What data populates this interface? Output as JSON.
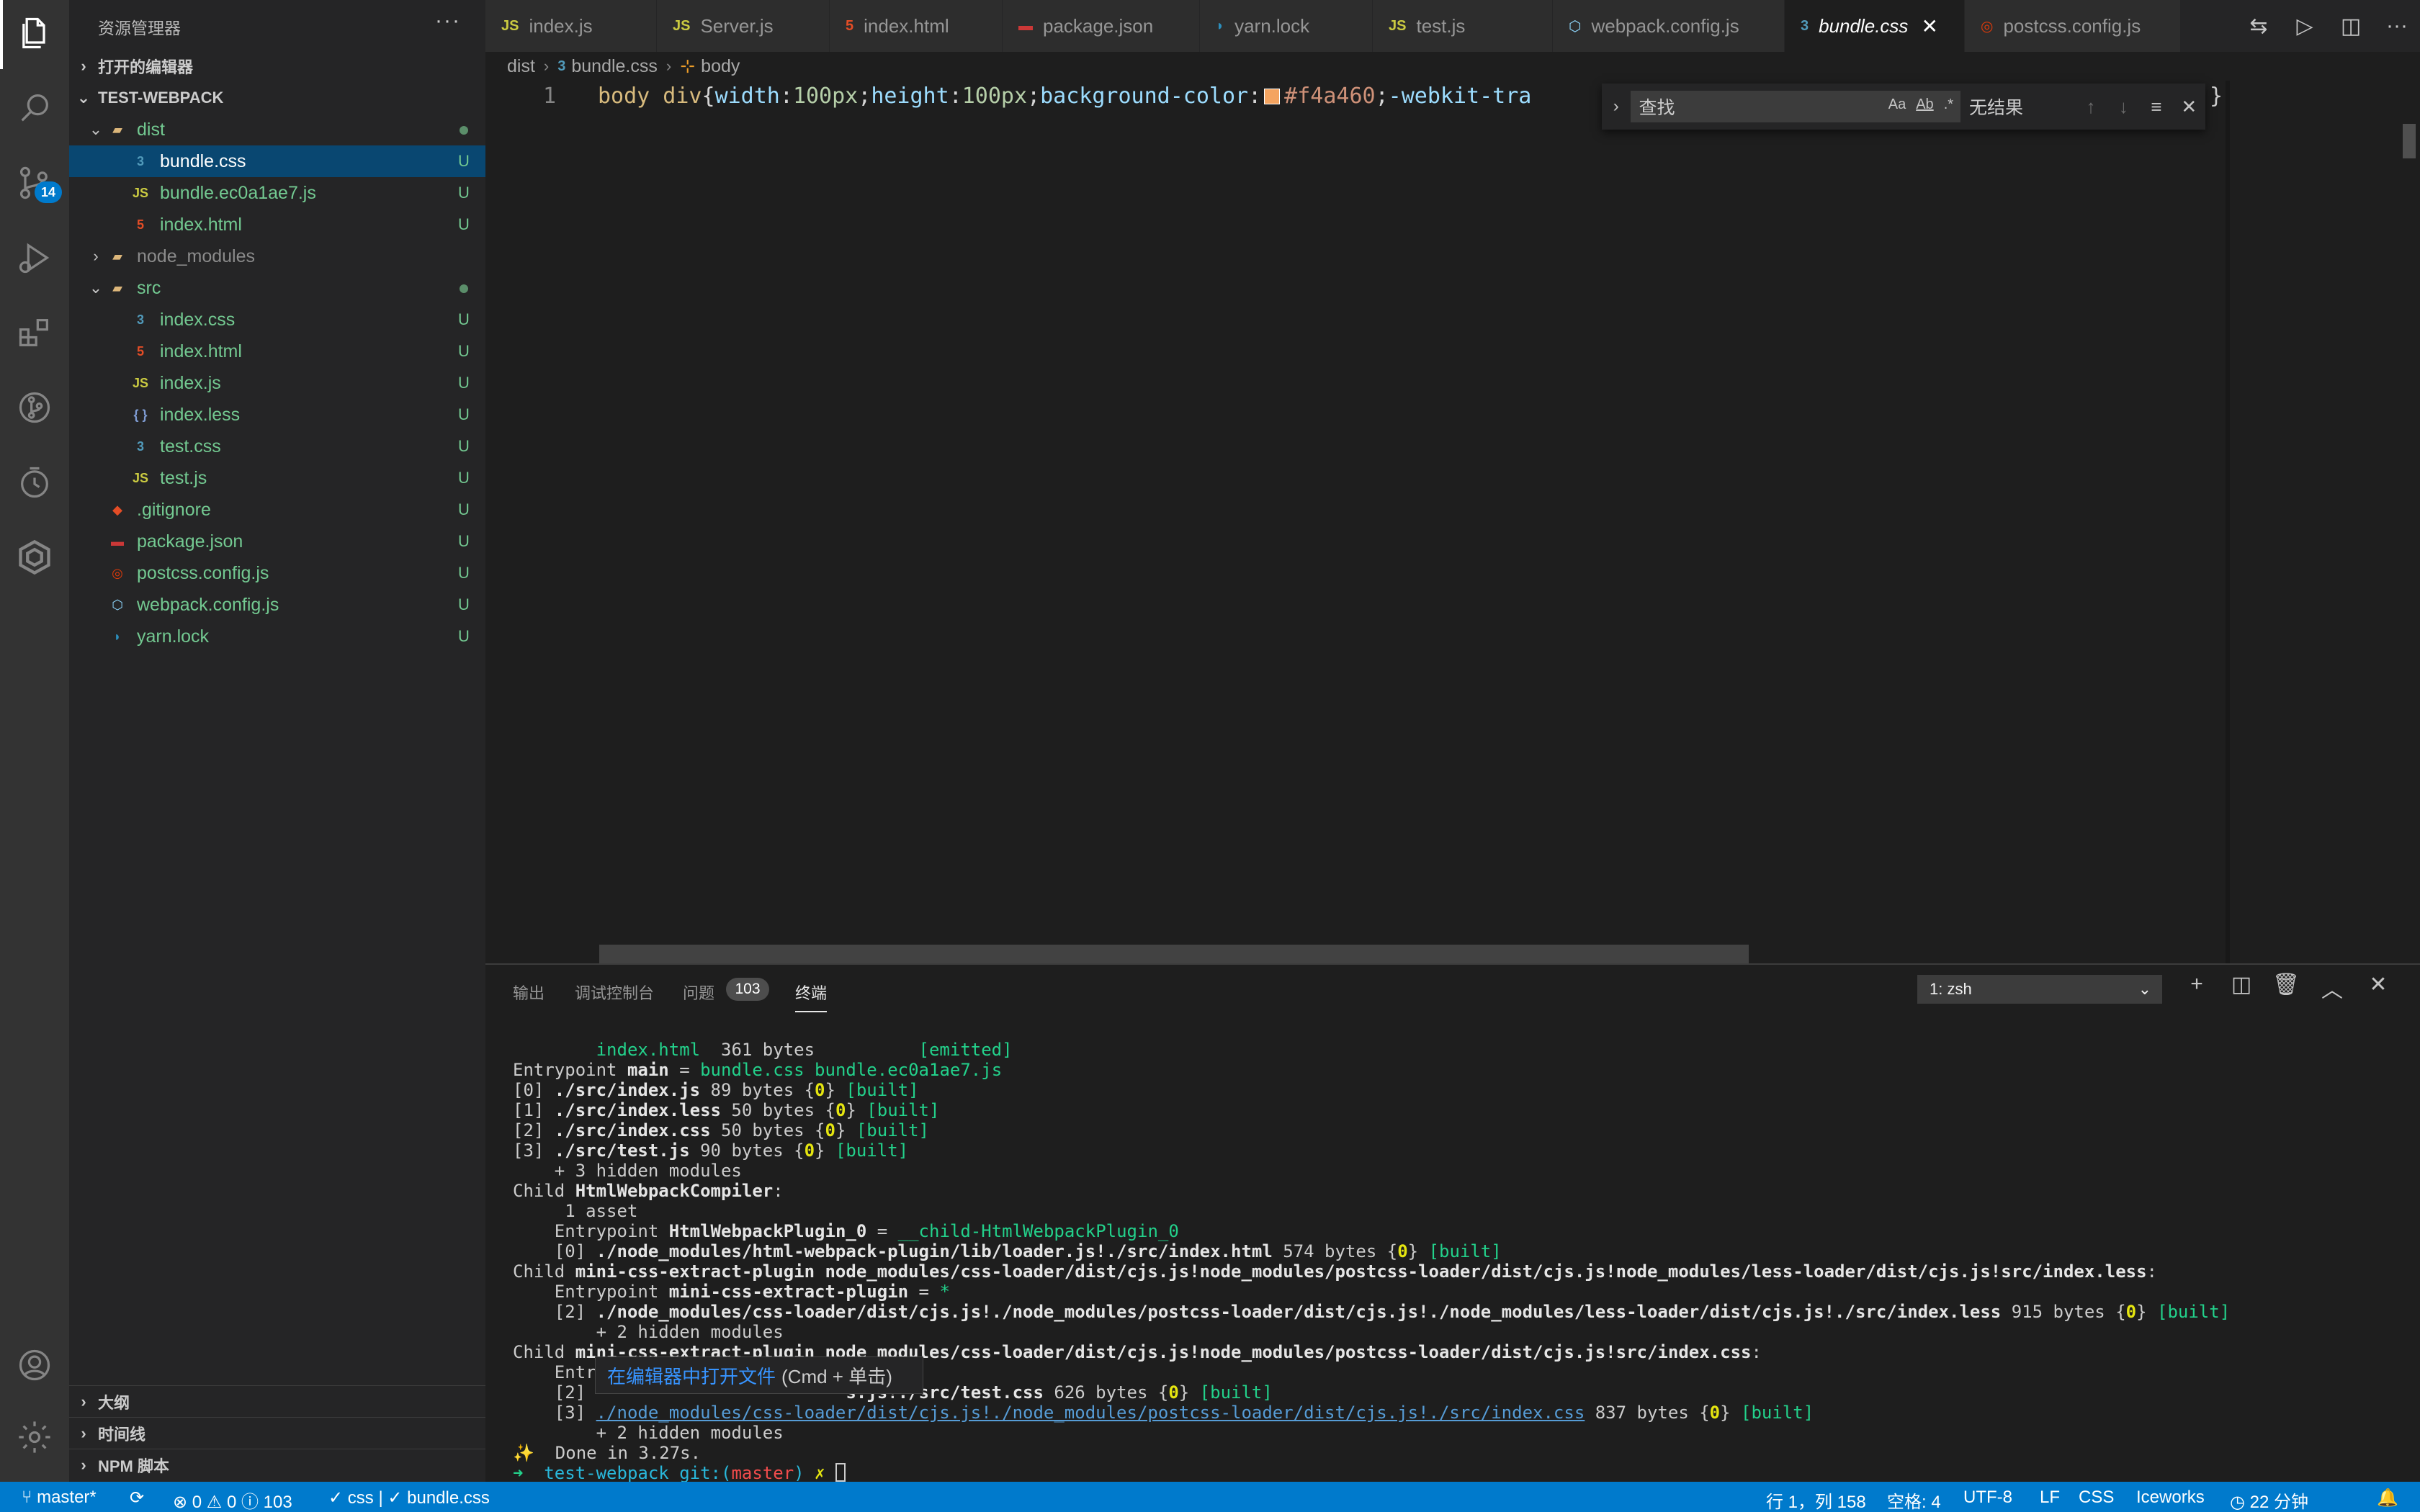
{
  "activity_bar": {
    "items": [
      "files-icon",
      "search-icon",
      "source-control-icon",
      "run-debug-icon",
      "extensions-icon",
      "git-graph-icon",
      "timeline-icon",
      "iceworks-icon"
    ],
    "source_control_badge": "14",
    "bottom_items": [
      "account-icon",
      "manage-gear-icon"
    ]
  },
  "sidebar": {
    "title": "资源管理器",
    "more": "···",
    "open_editors_label": "打开的编辑器",
    "project_label": "TEST-WEBPACK",
    "tree": [
      {
        "name": "dist",
        "kind": "folder",
        "status": "dot"
      },
      {
        "name": "bundle.css",
        "kind": "css",
        "status": "U"
      },
      {
        "name": "bundle.ec0a1ae7.js",
        "kind": "js",
        "status": "U"
      },
      {
        "name": "index.html",
        "kind": "html",
        "status": "U"
      },
      {
        "name": "node_modules",
        "kind": "folder",
        "status": ""
      },
      {
        "name": "src",
        "kind": "folder",
        "status": "dot"
      },
      {
        "name": "index.css",
        "kind": "css",
        "status": "U"
      },
      {
        "name": "index.html",
        "kind": "html",
        "status": "U"
      },
      {
        "name": "index.js",
        "kind": "js",
        "status": "U"
      },
      {
        "name": "index.less",
        "kind": "less",
        "status": "U"
      },
      {
        "name": "test.css",
        "kind": "css",
        "status": "U"
      },
      {
        "name": "test.js",
        "kind": "js",
        "status": "U"
      },
      {
        "name": ".gitignore",
        "kind": "git",
        "status": "U"
      },
      {
        "name": "package.json",
        "kind": "npm",
        "status": "U"
      },
      {
        "name": "postcss.config.js",
        "kind": "postcss",
        "status": "U"
      },
      {
        "name": "webpack.config.js",
        "kind": "webpack",
        "status": "U"
      },
      {
        "name": "yarn.lock",
        "kind": "yarn",
        "status": "U"
      }
    ],
    "outline_label": "大纲",
    "timeline_label": "时间线",
    "npm_scripts_label": "NPM 脚本"
  },
  "tabs": [
    {
      "label": "index.js",
      "icon": "JS"
    },
    {
      "label": "Server.js",
      "icon": "JS"
    },
    {
      "label": "index.html",
      "icon": "5"
    },
    {
      "label": "package.json",
      "icon": "npm"
    },
    {
      "label": "yarn.lock",
      "icon": "yarn"
    },
    {
      "label": "test.js",
      "icon": "JS"
    },
    {
      "label": "webpack.config.js",
      "icon": "wp"
    },
    {
      "label": "bundle.css",
      "icon": "3"
    },
    {
      "label": "postcss.config.js",
      "icon": "pc"
    }
  ],
  "tab_close": "✕",
  "breadcrumb": {
    "folder": "dist",
    "file": "bundle.css",
    "symbol": "body"
  },
  "editor": {
    "line_number": "1",
    "tokens": {
      "selector": "body div",
      "open": "{",
      "p1": "width",
      "v1": "100px",
      "p2": "height",
      "v2": "100px",
      "p3": "background-color",
      "color": "#f4a460",
      "p4": "-webkit-tra",
      "tail": "}"
    },
    "swatch_color": "#f4a460"
  },
  "find_widget": {
    "placeholder": "查找",
    "opt_case": "Aa",
    "opt_word": "Ab",
    "opt_regex": ".*",
    "result": "无结果"
  },
  "panel": {
    "tabs": [
      "输出",
      "调试控制台",
      "问题",
      "终端"
    ],
    "problems_count": "103",
    "terminal_select": "1: zsh",
    "terminal_lines": [
      [
        {
          "t": "        "
        },
        {
          "t": "index.html",
          "c": "t-g"
        },
        {
          "t": "  361 bytes          "
        },
        {
          "t": "[emitted]",
          "c": "t-g"
        }
      ],
      [
        {
          "t": "Entrypoint "
        },
        {
          "t": "main",
          "c": "t-b"
        },
        {
          "t": " = "
        },
        {
          "t": "bundle.css bundle.ec0a1ae7.js",
          "c": "t-g"
        }
      ],
      [
        {
          "t": "[0] "
        },
        {
          "t": "./src/index.js",
          "c": "t-b"
        },
        {
          "t": " 89 bytes "
        },
        {
          "t": "{",
          "c": ""
        },
        {
          "t": "0",
          "c": "t-y"
        },
        {
          "t": "} "
        },
        {
          "t": "[built]",
          "c": "t-g"
        }
      ],
      [
        {
          "t": "[1] "
        },
        {
          "t": "./src/index.less",
          "c": "t-b"
        },
        {
          "t": " 50 bytes {"
        },
        {
          "t": "0",
          "c": "t-y"
        },
        {
          "t": "} "
        },
        {
          "t": "[built]",
          "c": "t-g"
        }
      ],
      [
        {
          "t": "[2] "
        },
        {
          "t": "./src/index.css",
          "c": "t-b"
        },
        {
          "t": " 50 bytes {"
        },
        {
          "t": "0",
          "c": "t-y"
        },
        {
          "t": "} "
        },
        {
          "t": "[built]",
          "c": "t-g"
        }
      ],
      [
        {
          "t": "[3] "
        },
        {
          "t": "./src/test.js",
          "c": "t-b"
        },
        {
          "t": " 90 bytes {"
        },
        {
          "t": "0",
          "c": "t-y"
        },
        {
          "t": "} "
        },
        {
          "t": "[built]",
          "c": "t-g"
        }
      ],
      [
        {
          "t": "    + 3 hidden modules"
        }
      ],
      [
        {
          "t": "Child "
        },
        {
          "t": "HtmlWebpackCompiler",
          "c": "t-b"
        },
        {
          "t": ":"
        }
      ],
      [
        {
          "t": "     1 asset"
        }
      ],
      [
        {
          "t": "    Entrypoint "
        },
        {
          "t": "HtmlWebpackPlugin_0",
          "c": "t-b"
        },
        {
          "t": " = "
        },
        {
          "t": "__child-HtmlWebpackPlugin_0",
          "c": "t-g"
        }
      ],
      [
        {
          "t": "    [0] "
        },
        {
          "t": "./node_modules/html-webpack-plugin/lib/loader.js!./src/index.html",
          "c": "t-b"
        },
        {
          "t": " 574 bytes {"
        },
        {
          "t": "0",
          "c": "t-y"
        },
        {
          "t": "} "
        },
        {
          "t": "[built]",
          "c": "t-g"
        }
      ],
      [
        {
          "t": "Child "
        },
        {
          "t": "mini-css-extract-plugin node_modules/css-loader/dist/cjs.js!node_modules/postcss-loader/dist/cjs.js!node_modules/less-loader/dist/cjs.js!src/index.less",
          "c": "t-b"
        },
        {
          "t": ":"
        }
      ],
      [
        {
          "t": "    Entrypoint "
        },
        {
          "t": "mini-css-extract-plugin",
          "c": "t-b"
        },
        {
          "t": " = "
        },
        {
          "t": "*",
          "c": "t-g"
        }
      ],
      [
        {
          "t": "    [2] "
        },
        {
          "t": "./node_modules/css-loader/dist/cjs.js!./node_modules/postcss-loader/dist/cjs.js!./node_modules/less-loader/dist/cjs.js!./src/index.less",
          "c": "t-b"
        },
        {
          "t": " 915 bytes {"
        },
        {
          "t": "0",
          "c": "t-y"
        },
        {
          "t": "} "
        },
        {
          "t": "[built]",
          "c": "t-g"
        }
      ],
      [
        {
          "t": "        + 2 hidden modules"
        }
      ],
      [
        {
          "t": "Child "
        },
        {
          "t": "mini-css-extract-plugin node_modules/css-loader/dist/cjs.js!node_modules/postcss-loader/dist/cjs.js!src/index.css",
          "c": "t-b"
        },
        {
          "t": ":"
        }
      ],
      [
        {
          "t": "    Entr                        "
        },
        {
          "t": "*",
          "c": "t-g"
        }
      ],
      [
        {
          "t": "    [2]                         "
        },
        {
          "t": "s.js!./src/test.css",
          "c": "t-b"
        },
        {
          "t": " 626 bytes {"
        },
        {
          "t": "0",
          "c": "t-y"
        },
        {
          "t": "} "
        },
        {
          "t": "[built]",
          "c": "t-g"
        }
      ],
      [
        {
          "t": "    [3] "
        },
        {
          "t": "./node_modules/css-loader/dist/cjs.js!./node_modules/postcss-loader/dist/cjs.js!./src/index.css",
          "c": "t-lnk"
        },
        {
          "t": " 837 bytes {"
        },
        {
          "t": "0",
          "c": "t-y"
        },
        {
          "t": "} "
        },
        {
          "t": "[built]",
          "c": "t-g"
        }
      ],
      [
        {
          "t": "        + 2 hidden modules"
        }
      ],
      [
        {
          "t": "✨",
          "c": "t-y"
        },
        {
          "t": "  Done in 3.27s."
        }
      ],
      [
        {
          "t": "➜  ",
          "c": "t-g"
        },
        {
          "t": "test-webpack",
          "c": "t-cy"
        },
        {
          "t": " git:(",
          "c": "t-cy"
        },
        {
          "t": "master",
          "c": "t-r"
        },
        {
          "t": ")",
          "c": "t-cy"
        },
        {
          "t": " ✗ ",
          "c": "t-y"
        }
      ]
    ],
    "hover_link": "在编辑器中打开文件",
    "hover_keys": "(Cmd + 单击)"
  },
  "statusbar": {
    "branch": "master*",
    "sync": "⟳",
    "problems": "⊗ 0 ⚠ 0 ⓘ 103",
    "lang_check": "✓ css | ✓ bundle.css",
    "position": "行 1，列 158",
    "spaces": "空格: 4",
    "encoding": "UTF-8",
    "eol": "LF",
    "language": "CSS",
    "iceworks": "Iceworks",
    "time": "22 分钟"
  }
}
